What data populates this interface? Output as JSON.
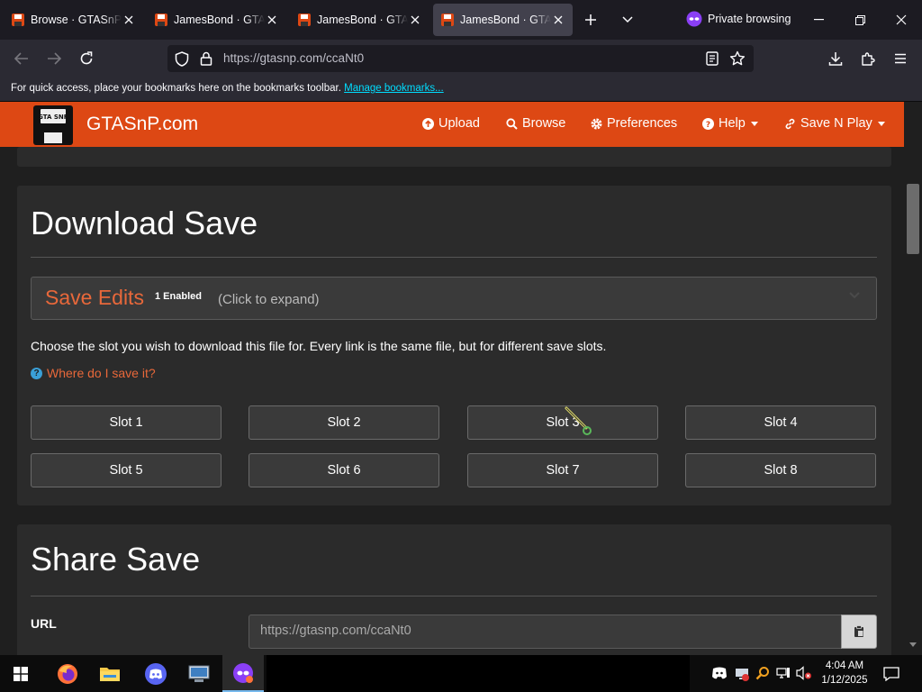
{
  "browser": {
    "tabs": [
      {
        "title": "Browse · GTASnP.com",
        "active": false
      },
      {
        "title": "JamesBond · GTASnP.com",
        "active": false
      },
      {
        "title": "JamesBond · GTASnP.com",
        "active": false
      },
      {
        "title": "JamesBond · GTASnP.com",
        "active": true
      }
    ],
    "private_label": "Private browsing",
    "url": "https://gtasnp.com/ccaNt0",
    "bookmarks_text": "For quick access, place your bookmarks here on the bookmarks toolbar.",
    "bookmarks_link": "Manage bookmarks..."
  },
  "site": {
    "brand": "GTASnP.com",
    "logo_text": "GTA SNP",
    "nav": {
      "upload": "Upload",
      "browse": "Browse",
      "preferences": "Preferences",
      "help": "Help",
      "save_n_play": "Save N Play"
    }
  },
  "download": {
    "heading": "Download Save",
    "edits_title": "Save Edits",
    "edits_badge": "1 Enabled",
    "edits_hint": "(Click to expand)",
    "description": "Choose the slot you wish to download this file for. Every link is the same file, but for different save slots.",
    "where_link": "Where do I save it?",
    "slots": [
      "Slot 1",
      "Slot 2",
      "Slot 3",
      "Slot 4",
      "Slot 5",
      "Slot 6",
      "Slot 7",
      "Slot 8"
    ]
  },
  "share": {
    "heading": "Share Save",
    "url_label": "URL",
    "url_value": "https://gtasnp.com/ccaNt0"
  },
  "taskbar": {
    "time": "4:04 AM",
    "date": "1/12/2025"
  },
  "colors": {
    "site_accent": "#dd4814",
    "link_orange": "#e8683a",
    "browser_link": "#00ddff"
  }
}
